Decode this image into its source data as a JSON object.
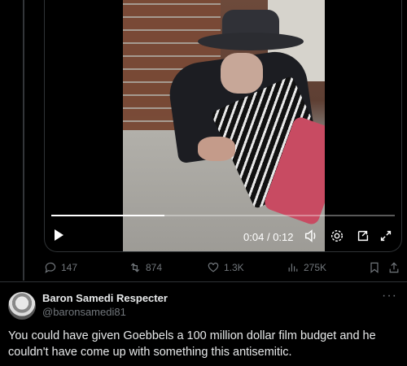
{
  "video": {
    "current_time": "0:04",
    "separator": "/",
    "duration": "0:12",
    "progress": 0.33
  },
  "actions": {
    "replies": "147",
    "reposts": "874",
    "likes": "1.3K",
    "views": "275K"
  },
  "reply": {
    "display_name": "Baron Samedi Respecter",
    "handle": "@baronsamedi81",
    "more": "···",
    "text": "You could have given Goebbels a 100 million dollar film budget and he couldn't have come up with something this antisemitic."
  },
  "colors": {
    "background": "#000000",
    "muted": "#71767b",
    "text": "#e7e9ea"
  }
}
